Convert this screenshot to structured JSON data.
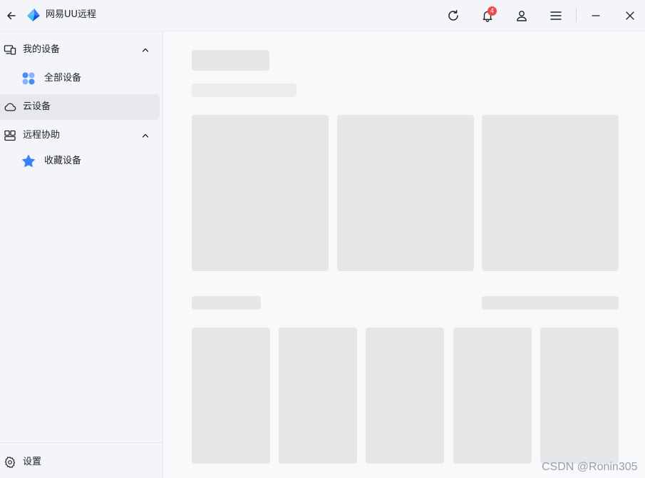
{
  "app": {
    "title": "网易UU远程"
  },
  "titlebar": {
    "notification_count": "4"
  },
  "sidebar": {
    "my_devices": "我的设备",
    "all_devices": "全部设备",
    "cloud_devices": "云设备",
    "remote_assist": "远程协助",
    "favorites": "收藏设备",
    "settings": "设置"
  },
  "colors": {
    "accent": "#3b82f6",
    "badge": "#f04b4b",
    "skeleton": "#e6e7e9"
  },
  "watermark": "CSDN @Ronin305"
}
